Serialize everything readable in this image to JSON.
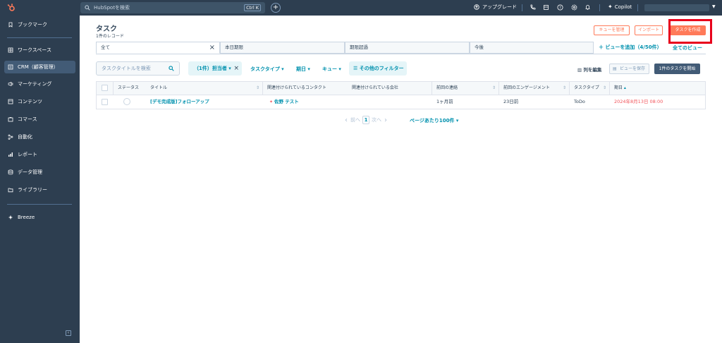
{
  "topbar": {
    "search_placeholder": "HubSpotを検索",
    "search_shortcut": "Ctrl K",
    "upgrade_label": "アップグレード",
    "copilot_label": "Copilot"
  },
  "sidebar": {
    "items": [
      {
        "label": "ブックマーク",
        "icon": "bookmark-icon"
      },
      {
        "label": "ワークスペース",
        "icon": "workspace-icon"
      },
      {
        "label": "CRM（顧客管理）",
        "icon": "crm-icon",
        "active": true
      },
      {
        "label": "マーケティング",
        "icon": "megaphone-icon"
      },
      {
        "label": "コンテンツ",
        "icon": "content-icon"
      },
      {
        "label": "コマース",
        "icon": "commerce-icon"
      },
      {
        "label": "自動化",
        "icon": "automation-icon"
      },
      {
        "label": "レポート",
        "icon": "report-icon"
      },
      {
        "label": "データ管理",
        "icon": "database-icon"
      },
      {
        "label": "ライブラリー",
        "icon": "folder-icon"
      },
      {
        "label": "Breeze",
        "icon": "breeze-icon"
      }
    ]
  },
  "header": {
    "title": "タスク",
    "record_count": "1件のレコード",
    "manage_queue": "キューを管理",
    "import": "インポート",
    "create_task": "タスクを作成"
  },
  "tabs": [
    {
      "label": "全て",
      "active": true
    },
    {
      "label": "本日期限"
    },
    {
      "label": "期限超過"
    },
    {
      "label": "今後"
    }
  ],
  "views": {
    "add_view": "ビューを追加（4/50件）",
    "all_views": "全てのビュー"
  },
  "filters": {
    "search_placeholder": "タスクタイトルを検索",
    "owner": "（1件）担当者",
    "task_type": "タスクタイプ",
    "due_date": "期日",
    "queue": "キュー",
    "more_filters": "その他のフィルター"
  },
  "actions": {
    "edit_columns": "列を編集",
    "save_view": "ビューを保存",
    "start_tasks": "1件のタスクを開始"
  },
  "table": {
    "columns": [
      "ステータス",
      "タイトル",
      "関連付けられているコンタクト",
      "関連付けられている会社",
      "前回の連絡",
      "前回のエンゲージメント",
      "タスクタイプ",
      "期日"
    ],
    "rows": [
      {
        "title": "[デモ完成版]フォローアップ",
        "contact": "佐野 テスト",
        "company": "",
        "last_contacted": "1ヶ月前",
        "last_engagement": "23日前",
        "task_type": "ToDo",
        "due_date": "2024年8月13日 08:00"
      }
    ]
  },
  "pagination": {
    "prev": "前へ",
    "page": "1",
    "next": "次へ",
    "per_page": "ページあたり100件"
  },
  "colors": {
    "nav_bg": "#2d3e50",
    "accent_orange": "#ff7a59",
    "link_teal": "#0091ae",
    "overdue_red": "#f2545b",
    "highlight_red": "#e8001c"
  }
}
